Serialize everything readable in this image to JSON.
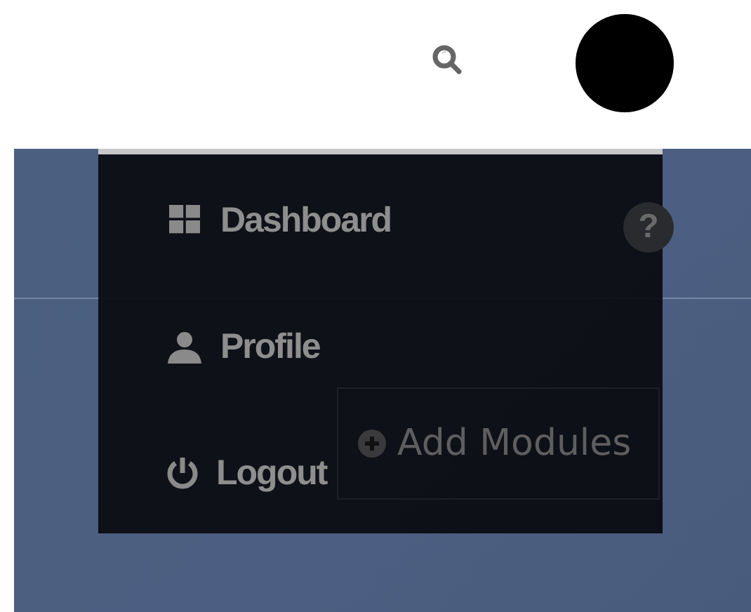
{
  "header": {
    "avatar": {
      "kind": "avatar"
    }
  },
  "background": {
    "help": "?",
    "add_button": "Add Modules"
  },
  "menu": {
    "items": [
      {
        "kind": "dashboard",
        "label": "Dashboard"
      },
      {
        "kind": "profile",
        "label": "Profile"
      },
      {
        "kind": "logout",
        "label": "Logout"
      }
    ]
  }
}
